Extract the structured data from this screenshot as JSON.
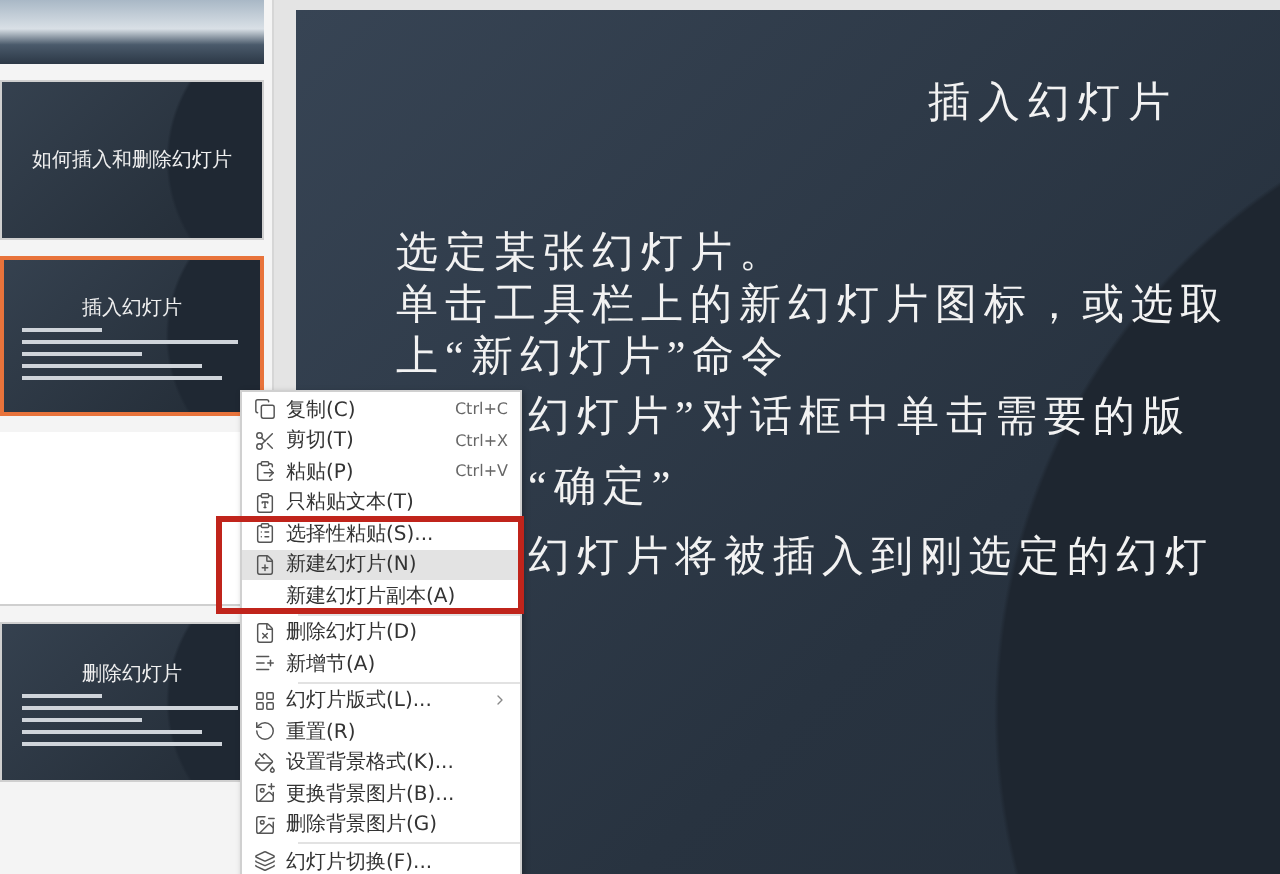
{
  "thumbnails": [
    {
      "kind": "photo",
      "selected": false
    },
    {
      "kind": "title",
      "selected": false,
      "title": "如何插入和删除幻灯片"
    },
    {
      "kind": "content",
      "selected": true,
      "title": "插入幻灯片"
    },
    {
      "kind": "blank",
      "selected": false
    },
    {
      "kind": "content",
      "selected": false,
      "title": "删除幻灯片"
    }
  ],
  "slide": {
    "title": "插入幻灯片",
    "lines": [
      {
        "text": "选定某张幻灯片。",
        "obscured": false
      },
      {
        "text": "单击工具栏上的新幻灯片图标，或选取",
        "obscured": false
      },
      {
        "text": "上“新幻灯片”命令",
        "obscured": false
      },
      {
        "text": "幻灯片”对话框中单击需要的版",
        "obscured": true
      },
      {
        "text": "“确定”",
        "obscured": true
      },
      {
        "text": "幻灯片将被插入到刚选定的幻灯",
        "obscured": true
      }
    ]
  },
  "context_menu": [
    {
      "kind": "item",
      "label": "复制(C)",
      "shortcut": "Ctrl+C",
      "selected": false,
      "submenu": false
    },
    {
      "kind": "item",
      "label": "剪切(T)",
      "shortcut": "Ctrl+X",
      "selected": false,
      "submenu": false
    },
    {
      "kind": "item",
      "label": "粘贴(P)",
      "shortcut": "Ctrl+V",
      "selected": false,
      "submenu": false
    },
    {
      "kind": "item",
      "label": "只粘贴文本(T)",
      "selected": false,
      "submenu": false
    },
    {
      "kind": "item",
      "label": "选择性粘贴(S)...",
      "selected": false,
      "submenu": false
    },
    {
      "kind": "item",
      "label": "新建幻灯片(N)",
      "selected": true,
      "submenu": false
    },
    {
      "kind": "item",
      "label": "新建幻灯片副本(A)",
      "selected": false,
      "submenu": false
    },
    {
      "kind": "separator"
    },
    {
      "kind": "item",
      "label": "删除幻灯片(D)",
      "selected": false,
      "submenu": false
    },
    {
      "kind": "item",
      "label": "新增节(A)",
      "selected": false,
      "submenu": false
    },
    {
      "kind": "separator"
    },
    {
      "kind": "item",
      "label": "幻灯片版式(L)...",
      "selected": false,
      "submenu": true
    },
    {
      "kind": "item",
      "label": "重置(R)",
      "selected": false,
      "submenu": false
    },
    {
      "kind": "item",
      "label": "设置背景格式(K)...",
      "selected": false,
      "submenu": false
    },
    {
      "kind": "item",
      "label": "更换背景图片(B)...",
      "selected": false,
      "submenu": false
    },
    {
      "kind": "item",
      "label": "删除背景图片(G)",
      "selected": false,
      "submenu": false
    },
    {
      "kind": "separator"
    },
    {
      "kind": "item",
      "label": "幻灯片切换(F)...",
      "selected": false,
      "submenu": false
    }
  ]
}
